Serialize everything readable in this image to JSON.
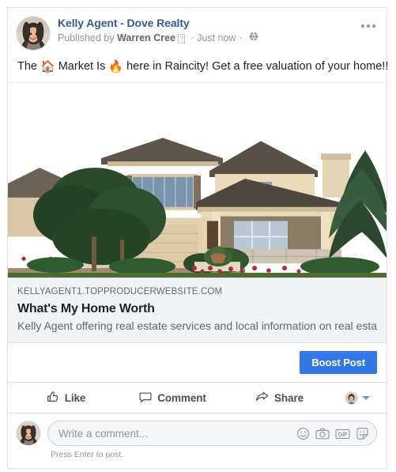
{
  "post": {
    "author": {
      "page_name": "Kelly Agent - Dove Realty",
      "avatar_name": "profile-photo-woman"
    },
    "byline": {
      "published_by_prefix": "Published by",
      "publisher_name": "Warren Cree",
      "help_badge": "?",
      "separator": "·",
      "timestamp": "Just now",
      "audience_icon": "globe-icon"
    },
    "more_options_icon": "ellipsis-icon",
    "message": {
      "part1": "The ",
      "emoji1": "🏠",
      "part2": " Market Is ",
      "emoji2": "🔥",
      "part3": " here in Raincity! Get a free valuation of your home!!"
    },
    "photo": {
      "alt": "two-story-beige-house-with-landscaping"
    },
    "link_preview": {
      "domain": "KELLYAGENT1.TOPPRODUCERWEBSITE.COM",
      "title": "What's My Home Worth",
      "description": "Kelly Agent offering real estate services and local information on real estat…"
    },
    "boost": {
      "label": "Boost Post"
    },
    "actions": [
      {
        "label": "Like",
        "icon": "thumbs-up-icon"
      },
      {
        "label": "Comment",
        "icon": "comment-bubble-icon"
      },
      {
        "label": "Share",
        "icon": "share-arrow-icon"
      }
    ],
    "audience_selector": {
      "avatar_name": "mini-profile-photo",
      "caret_icon": "chevron-down-icon"
    },
    "composer": {
      "avatar_name": "commenter-profile-photo",
      "placeholder": "Write a comment...",
      "value": "",
      "hint": "Press Enter to post.",
      "icons": [
        {
          "name": "emoji-icon"
        },
        {
          "name": "camera-icon"
        },
        {
          "name": "gif-icon",
          "label": "GIF"
        },
        {
          "name": "sticker-icon"
        }
      ]
    }
  },
  "colors": {
    "brand_blue": "#3578e5",
    "link_blue": "#365899",
    "text_primary": "#1d2129",
    "text_secondary": "#606770",
    "text_muted": "#90949c",
    "card_border": "#dddfe2",
    "link_card_bg": "#f2f3f5"
  }
}
